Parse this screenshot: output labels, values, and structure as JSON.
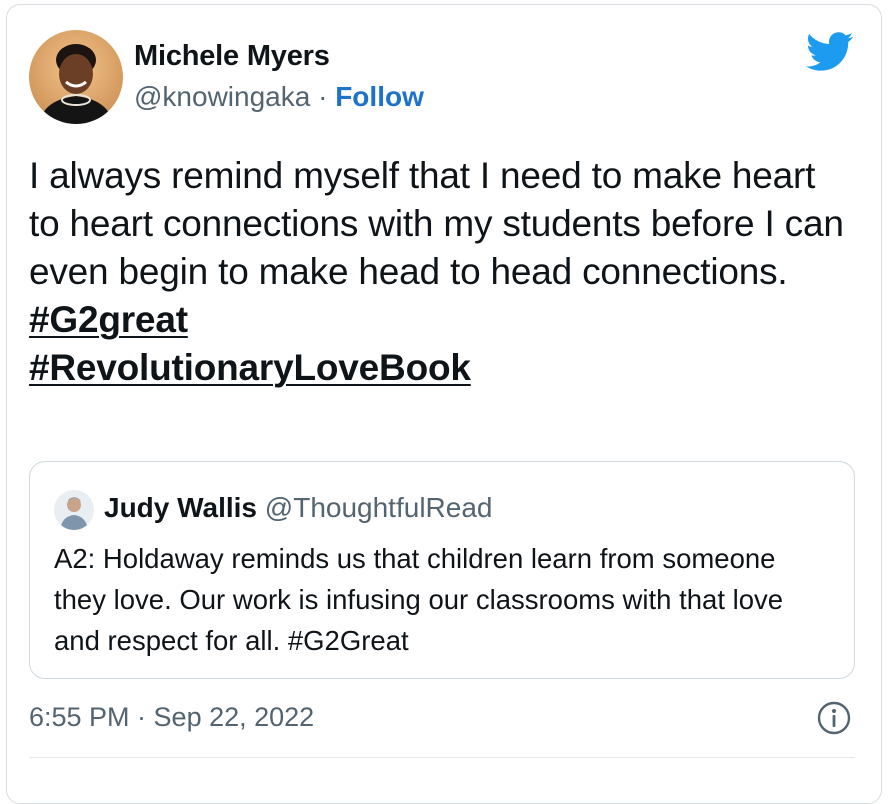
{
  "author": {
    "name": "Michele Myers",
    "handle": "@knowingaka",
    "separator": "·",
    "follow_label": "Follow",
    "avatar_icon": "profile-photo"
  },
  "brand": {
    "icon": "twitter-bird-icon",
    "color": "#1d9bf0"
  },
  "tweet": {
    "text": "I always remind myself that I need to make heart to heart connections with my students before I can even begin to make head to head connections.",
    "hashtags": [
      "#G2great",
      "#RevolutionaryLoveBook"
    ]
  },
  "quoted_tweet": {
    "name": "Judy Wallis",
    "handle": "@ThoughtfulRead",
    "text": "A2: Holdaway reminds us that children learn from someone they love. Our work is infusing our classrooms with that love and respect for all. #G2Great"
  },
  "footer": {
    "timestamp": "6:55 PM · Sep 22, 2022",
    "info_icon": "info-icon"
  },
  "colors": {
    "link": "#1d73c9",
    "secondary_text": "#536471",
    "border": "#cfd9de"
  }
}
